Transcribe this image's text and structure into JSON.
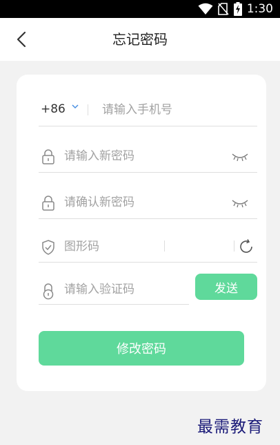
{
  "status_bar": {
    "time": "1:30",
    "icons": [
      "wifi-icon",
      "no-sim-icon",
      "battery-charging-icon"
    ]
  },
  "header": {
    "title": "忘记密码",
    "back_icon": "chevron-left-icon"
  },
  "form": {
    "country_code": "+86",
    "phone": {
      "value": "",
      "placeholder": "请输入手机号"
    },
    "new_password": {
      "value": "",
      "placeholder": "请输入新密码"
    },
    "confirm_password": {
      "value": "",
      "placeholder": "请确认新密码"
    },
    "captcha": {
      "value": "",
      "placeholder": "图形码"
    },
    "verify_code": {
      "value": "",
      "placeholder": "请输入验证码"
    },
    "send_label": "发送",
    "submit_label": "修改密码"
  },
  "watermark": "最需教育",
  "colors": {
    "accent": "#5fd99b",
    "accent_blue": "#4a90e2",
    "background": "#f2f2f2",
    "card": "#ffffff",
    "placeholder": "#a2a2a2",
    "watermark": "#1a1a78"
  }
}
